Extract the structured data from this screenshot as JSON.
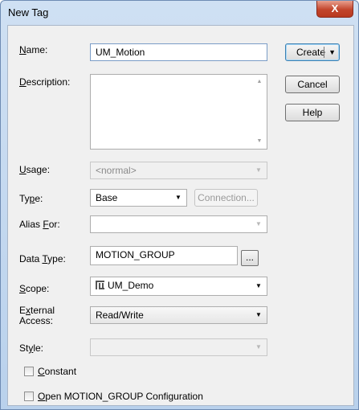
{
  "window": {
    "title": "New Tag",
    "close_glyph": "X"
  },
  "fields": {
    "name": {
      "label_pre": "",
      "label_key": "N",
      "label_post": "ame:",
      "value": "UM_Motion"
    },
    "description": {
      "label_pre": "",
      "label_key": "D",
      "label_post": "escription:",
      "value": ""
    },
    "usage": {
      "label_pre": "",
      "label_key": "U",
      "label_post": "sage:",
      "value": "<normal>"
    },
    "type": {
      "label_pre": "Ty",
      "label_key": "p",
      "label_post": "e:",
      "value": "Base"
    },
    "alias_for": {
      "label_pre": "Alias ",
      "label_key": "F",
      "label_post": "or:",
      "value": ""
    },
    "data_type": {
      "label_pre": "Data ",
      "label_key": "T",
      "label_post": "ype:",
      "value": "MOTION_GROUP",
      "browse_label": "..."
    },
    "scope": {
      "label_pre": "",
      "label_key": "S",
      "label_post": "cope:",
      "value": "UM_Demo",
      "icon": "controller-icon"
    },
    "external_access": {
      "label_line1_pre": "E",
      "label_line1_key": "x",
      "label_line1_post": "ternal",
      "label_line2": "Access:",
      "value": "Read/Write"
    },
    "style": {
      "label_pre": "St",
      "label_key": "y",
      "label_post": "le:",
      "value": ""
    }
  },
  "buttons": {
    "create": "Create",
    "cancel": "Cancel",
    "help": "Help",
    "connection": "Connection..."
  },
  "checkboxes": {
    "constant": {
      "label_pre": "",
      "label_key": "C",
      "label_post": "onstant",
      "checked": false
    },
    "open_config": {
      "label_pre": "",
      "label_key": "O",
      "label_post": "pen MOTION_GROUP Configuration",
      "checked": false
    }
  }
}
